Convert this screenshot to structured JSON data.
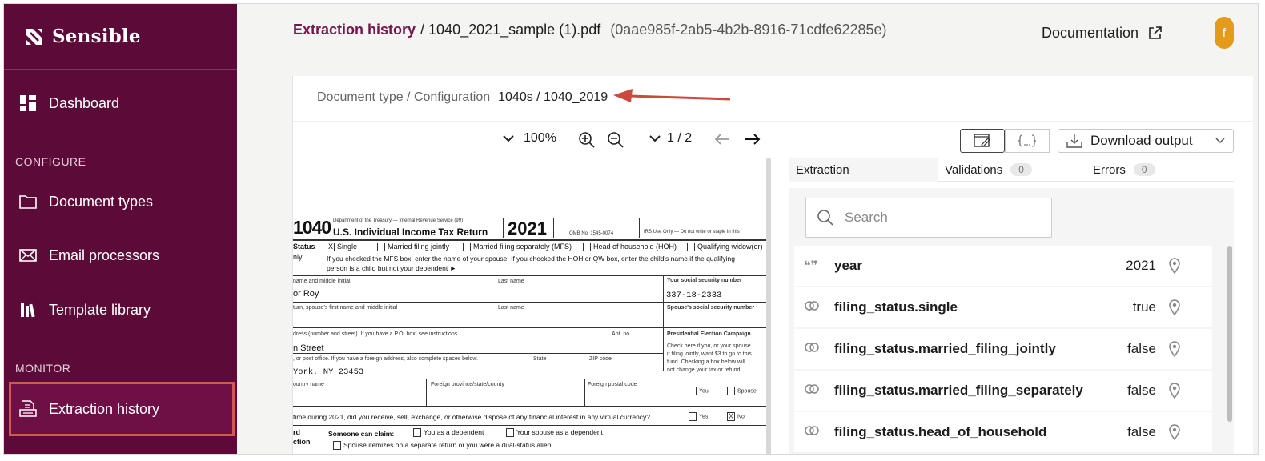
{
  "brand": {
    "name": "Sensible"
  },
  "sidebar": {
    "items": [
      {
        "label": "Dashboard"
      },
      {
        "label": "Document types"
      },
      {
        "label": "Email processors"
      },
      {
        "label": "Template library"
      },
      {
        "label": "Extraction history"
      }
    ],
    "sections": {
      "configure": "CONFIGURE",
      "monitor": "MONITOR"
    }
  },
  "header": {
    "breadcrumb_link": "Extraction history",
    "file": "/ 1040_2021_sample (1).pdf",
    "id": "(0aae985f-2ab5-4b2b-8916-71cdfe62285e)",
    "documentation": "Documentation",
    "avatar": "f"
  },
  "doctype": {
    "label": "Document type / Configuration",
    "value": "1040s / 1040_2019"
  },
  "toolbar": {
    "zoom": "100%",
    "page": "1 / 2",
    "download_label": "Download output"
  },
  "tabs": [
    {
      "label": "Extraction",
      "count": ""
    },
    {
      "label": "Validations",
      "count": "0"
    },
    {
      "label": "Errors",
      "count": "0"
    }
  ],
  "search": {
    "placeholder": "Search"
  },
  "results": [
    {
      "key": "year",
      "value": "2021",
      "icon": "quote-icon"
    },
    {
      "key": "filing_status.single",
      "value": "true",
      "icon": "link-icon"
    },
    {
      "key": "filing_status.married_filing_jointly",
      "value": "false",
      "icon": "link-icon"
    },
    {
      "key": "filing_status.married_filing_separately",
      "value": "false",
      "icon": "link-icon"
    },
    {
      "key": "filing_status.head_of_household",
      "value": "false",
      "icon": "link-icon"
    }
  ],
  "form": {
    "form_no": "1040",
    "dept": "Department of the Treasury — Internal Revenue Service (99)",
    "title": "U.S. Individual Income Tax Return",
    "year": "2021",
    "omb": "OMB No. 1545-0074",
    "irs_use": "IRS Use Only — Do not write or staple in this",
    "status_label": "Status",
    "only": "nly",
    "opt_single": "Single",
    "opt_mfj": "Married filing jointly",
    "opt_mfs": "Married filing separately (MFS)",
    "opt_hoh": "Head of household (HOH)",
    "opt_qw": "Qualifying widow(er)",
    "mfs_note": "If you checked the MFS box, enter the name of your spouse. If you checked the HOH or QW box, enter the child's name if the qualifying",
    "mfs_note2": "person is a child but not your dependent ►",
    "name_label": "name and middle initial",
    "last_name": "Last name",
    "ssn_label": "Your social security number",
    "name_val": "or Roy",
    "ssn_val": "337-18-2333",
    "spouse_label": "turn, spouse's first name and middle initial",
    "last_name2": "Last name",
    "spouse_ssn": "Spouse's social security number",
    "addr_label": "dress (number and street). If you have a P.O. box, see instructions.",
    "apt": "Apt. no.",
    "pec": "Presidential Election Campaign",
    "addr_val": "n Street",
    "city_label": ", or post office. If you have a foreign address, also complete spaces below.",
    "state": "State",
    "zip": "ZIP code",
    "pec_note1": "Check here if you, or your spouse",
    "pec_note2": "if filing jointly, want $3 to go to this",
    "pec_note3": "fund. Checking a box below will",
    "pec_note4": "not change your tax or refund.",
    "city_val": "York, NY  23453",
    "country": "ountry name",
    "province": "Foreign province/state/county",
    "postal": "Foreign postal code",
    "you": "You",
    "spouse": "Spouse",
    "vc_q": "time during 2021, did you receive, sell, exchange, or otherwise dispose of any financial interest in any virtual currency?",
    "yes": "Yes",
    "no": "No",
    "std": "rd",
    "ction": "ction",
    "someone": "Someone can claim:",
    "you_dep": "You as a dependent",
    "spouse_dep": "Your spouse as a dependent",
    "itemizes": "Spouse itemizes on a separate return or you were a dual-status alien"
  }
}
